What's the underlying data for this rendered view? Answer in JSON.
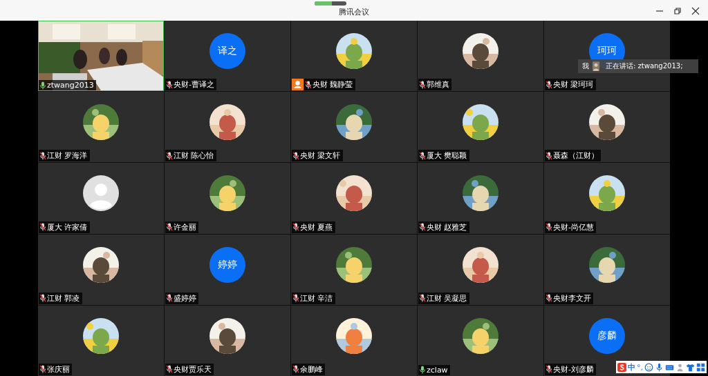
{
  "window": {
    "title": "腾讯会议",
    "loading": {
      "level": 0.55
    }
  },
  "tiles": [
    {
      "name": "ztwang2013",
      "kind": "video",
      "muted": false,
      "speaking": true,
      "host": false
    },
    {
      "name": "央财-曹译之",
      "kind": "initials",
      "avatar_text": "译之",
      "muted": true,
      "speaking": false,
      "host": false
    },
    {
      "name": "央财 魏静莹",
      "kind": "picture",
      "muted": true,
      "speaking": false,
      "host": true
    },
    {
      "name": "郭维真",
      "kind": "picture",
      "muted": true,
      "speaking": false,
      "host": false
    },
    {
      "name": "央财 梁珂珂",
      "kind": "initials",
      "avatar_text": "珂珂",
      "muted": true,
      "speaking": false,
      "host": false
    },
    {
      "name": "江财 罗海洋",
      "kind": "picture",
      "muted": true,
      "speaking": false,
      "host": false
    },
    {
      "name": "江财  陈心怡",
      "kind": "picture",
      "muted": true,
      "speaking": false,
      "host": false
    },
    {
      "name": "央财 梁文轩",
      "kind": "picture",
      "muted": true,
      "speaking": false,
      "host": false
    },
    {
      "name": "厦大 樊聪颖",
      "kind": "picture",
      "muted": true,
      "speaking": false,
      "host": false
    },
    {
      "name": "聂森（江财）",
      "kind": "picture",
      "muted": true,
      "speaking": false,
      "host": false
    },
    {
      "name": "厦大 许家倩",
      "kind": "default",
      "muted": true,
      "speaking": false,
      "host": false
    },
    {
      "name": "许金丽",
      "kind": "picture",
      "muted": true,
      "speaking": false,
      "host": false
    },
    {
      "name": "央财 夏燕",
      "kind": "picture",
      "muted": true,
      "speaking": false,
      "host": false
    },
    {
      "name": "央财 赵雅芝",
      "kind": "picture",
      "muted": true,
      "speaking": false,
      "host": false
    },
    {
      "name": "央财-尚亿慧",
      "kind": "picture",
      "muted": true,
      "speaking": false,
      "host": false
    },
    {
      "name": "江财 郭凌",
      "kind": "picture",
      "muted": true,
      "speaking": false,
      "host": false
    },
    {
      "name": "盛婷婷",
      "kind": "initials",
      "avatar_text": "婷婷",
      "muted": true,
      "speaking": false,
      "host": false
    },
    {
      "name": "江财 辛洁",
      "kind": "picture",
      "muted": true,
      "speaking": false,
      "host": false
    },
    {
      "name": "江财 吴凝思",
      "kind": "picture",
      "muted": true,
      "speaking": false,
      "host": false
    },
    {
      "name": "央财李文开",
      "kind": "picture",
      "muted": true,
      "speaking": false,
      "host": false
    },
    {
      "name": "张庆丽",
      "kind": "picture",
      "muted": true,
      "speaking": false,
      "host": false
    },
    {
      "name": "央财贾乐天",
      "kind": "picture",
      "muted": true,
      "speaking": false,
      "host": false
    },
    {
      "name": "余鹏峰",
      "kind": "picture",
      "muted": true,
      "speaking": false,
      "host": false
    },
    {
      "name": "zclaw",
      "kind": "picture",
      "muted": false,
      "speaking": false,
      "host": false
    },
    {
      "name": "央财-刘彦麟",
      "kind": "initials",
      "avatar_text": "彦麟",
      "muted": true,
      "speaking": false,
      "host": false
    }
  ],
  "speaking_indicator": {
    "me": "我",
    "text": "正在讲话: ztwang2013;"
  },
  "ime_toolbar": {
    "mode": "中",
    "punctuation": "°,"
  }
}
